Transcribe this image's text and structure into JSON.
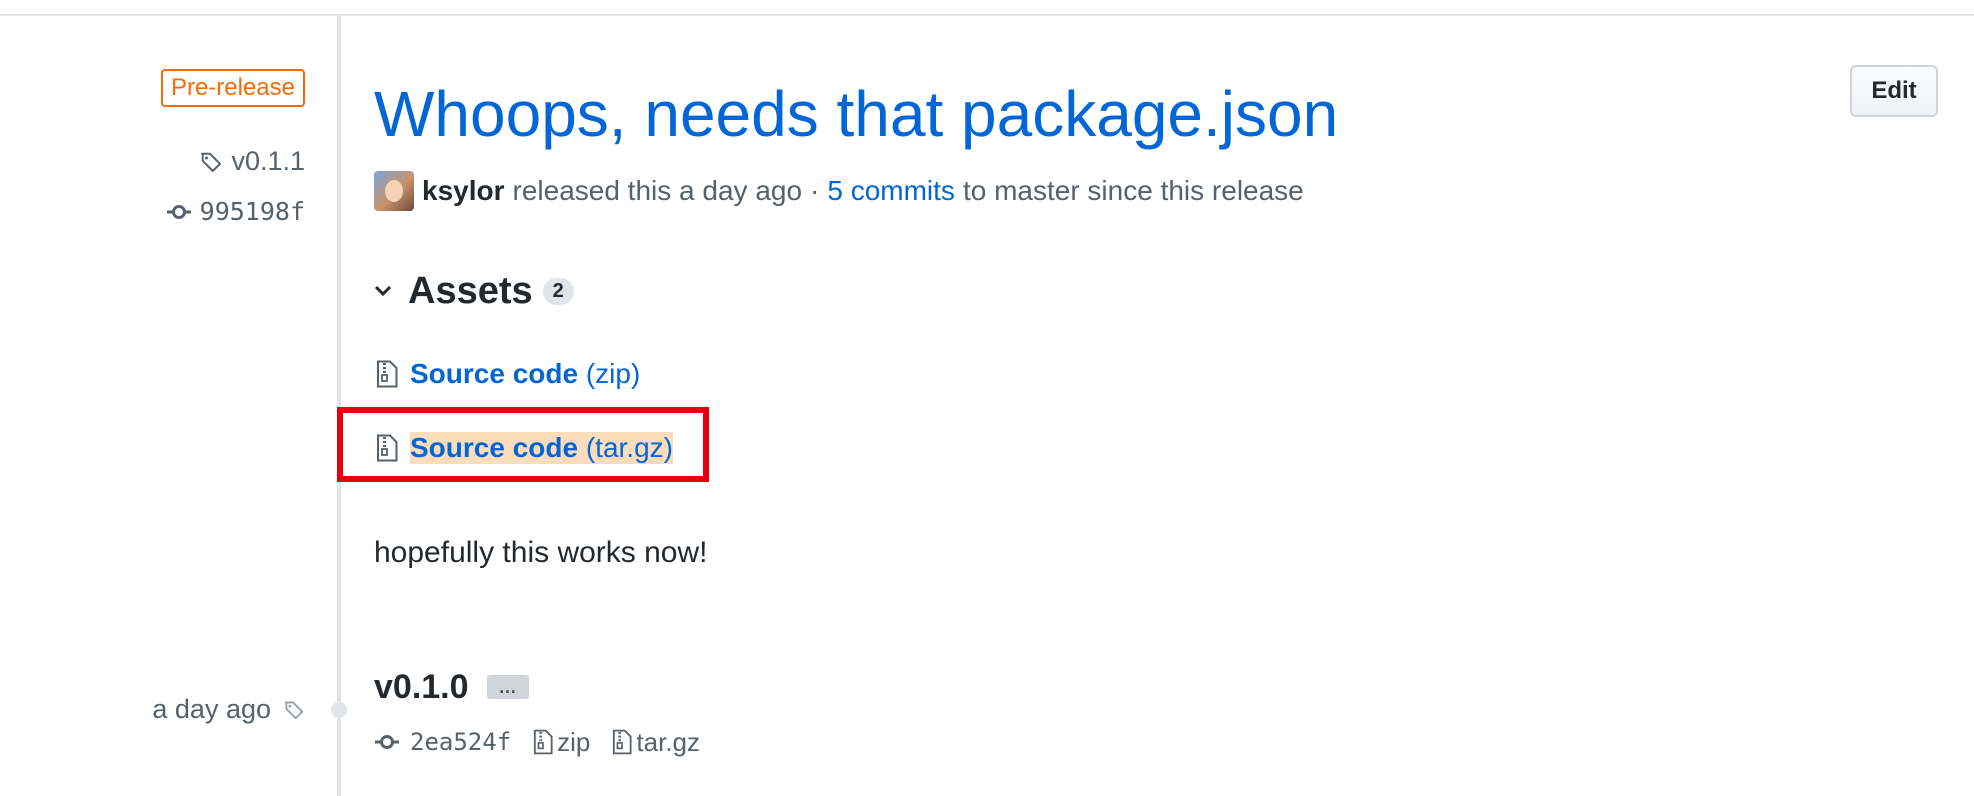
{
  "badge": {
    "label": "Pre-release"
  },
  "tag": {
    "name": "v0.1.1"
  },
  "commit": {
    "sha": "995198f"
  },
  "release": {
    "title": "Whoops, needs that package.json",
    "author": "ksylor",
    "released_text": "released this a day ago",
    "separator": "·",
    "commits_link": "5 commits",
    "commits_suffix": "to master since this release",
    "body": "hopefully this works now!"
  },
  "edit_button": {
    "label": "Edit"
  },
  "assets": {
    "title": "Assets",
    "count": "2",
    "items": [
      {
        "name": "Source code",
        "ext": "(zip)"
      },
      {
        "name": "Source code",
        "ext": "(tar.gz)"
      }
    ]
  },
  "previous_release": {
    "date": "a day ago",
    "tag": "v0.1.0",
    "more_label": "…",
    "sha": "2ea524f",
    "zip_label": "zip",
    "targz_label": "tar.gz"
  },
  "colors": {
    "link": "#0366d6",
    "prerelease": "#f66a0a",
    "highlight_box": "#e3000f",
    "selection": "#fbdcbb"
  },
  "icons": [
    "tag-icon",
    "git-commit-icon",
    "chevron-down-icon",
    "file-zip-icon"
  ]
}
